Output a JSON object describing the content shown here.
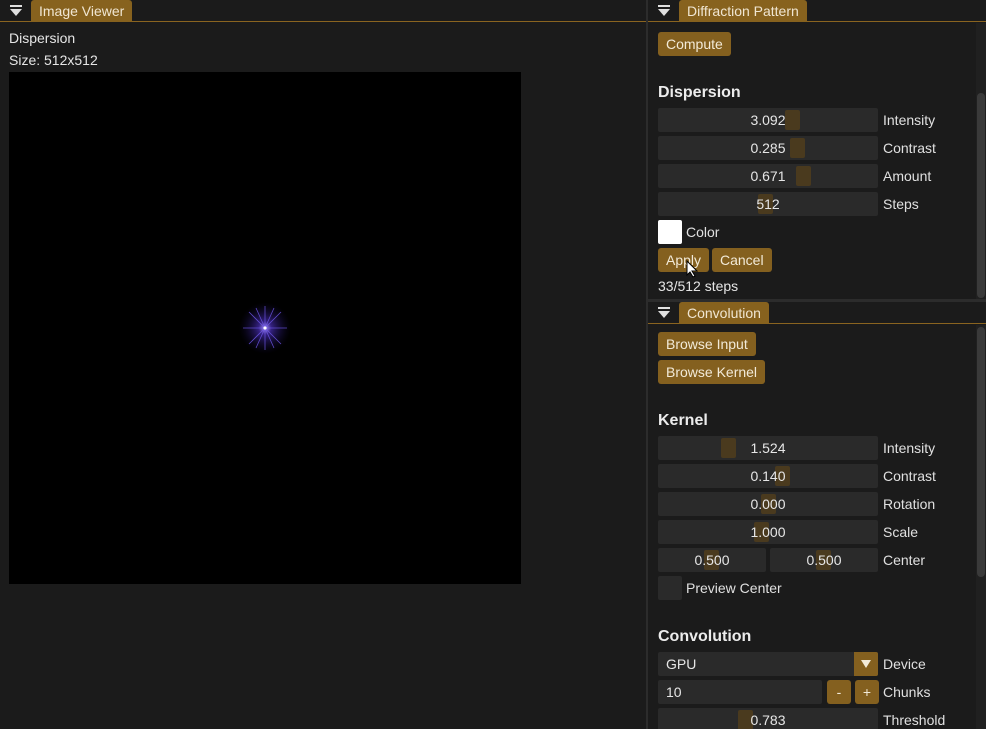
{
  "image_viewer": {
    "tab_label": "Image Viewer",
    "image_name": "Dispersion",
    "size_text": "Size: 512x512"
  },
  "diffraction": {
    "tab_label": "Diffraction Pattern",
    "compute_label": "Compute",
    "dispersion_heading": "Dispersion",
    "sliders": [
      {
        "value": "3.092",
        "label": "Intensity"
      },
      {
        "value": "0.285",
        "label": "Contrast"
      },
      {
        "value": "0.671",
        "label": "Amount"
      },
      {
        "value": "512",
        "label": "Steps"
      }
    ],
    "color_label": "Color",
    "color_value": "#ffffff",
    "apply_label": "Apply",
    "cancel_label": "Cancel",
    "progress_text": "33/512 steps"
  },
  "convolution": {
    "tab_label": "Convolution",
    "browse_input_label": "Browse Input",
    "browse_kernel_label": "Browse Kernel",
    "kernel_heading": "Kernel",
    "kernel_sliders": [
      {
        "value": "1.524",
        "label": "Intensity"
      },
      {
        "value": "0.140",
        "label": "Contrast"
      },
      {
        "value": "0.000",
        "label": "Rotation"
      },
      {
        "value": "1.000",
        "label": "Scale"
      }
    ],
    "center_x": "0.500",
    "center_y": "0.500",
    "center_label": "Center",
    "preview_center_label": "Preview Center",
    "convolution_heading": "Convolution",
    "device_value": "GPU",
    "device_label": "Device",
    "chunks_value": "10",
    "chunks_label": "Chunks",
    "minus_label": "-",
    "plus_label": "+",
    "threshold_value": "0.783",
    "threshold_label": "Threshold"
  },
  "colors": {
    "accent": "#84601f",
    "panel_bg": "#1b1b1b",
    "frame_bg": "#2a2a2a"
  }
}
